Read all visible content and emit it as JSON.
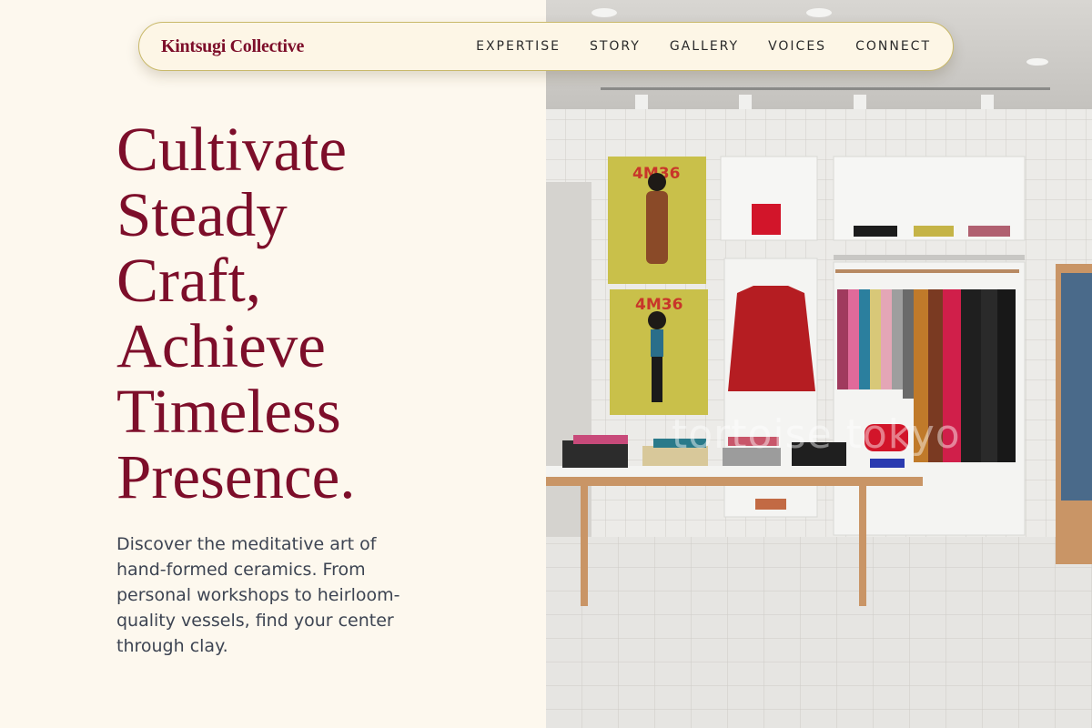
{
  "brand": {
    "name": "Kintsugi Collective"
  },
  "nav": {
    "items": [
      {
        "label": "EXPERTISE"
      },
      {
        "label": "STORY"
      },
      {
        "label": "GALLERY"
      },
      {
        "label": "VOICES"
      },
      {
        "label": "CONNECT"
      }
    ]
  },
  "hero": {
    "title_lines": [
      "Cultivate",
      "Steady",
      "Craft,",
      "Achieve",
      "Timeless",
      "Presence."
    ],
    "description": "Discover the meditative art of hand-formed ceramics. From personal workshops to heirloom-quality vessels, find your center through clay."
  },
  "image": {
    "poster_label_top": "4M36",
    "poster_label_bottom": "4M36",
    "watermark": "tortoise tokyo"
  },
  "colors": {
    "background": "#fdf8ee",
    "accent": "#7d0e2a",
    "nav_border": "#c9b96a",
    "body_text": "#3d4452"
  }
}
